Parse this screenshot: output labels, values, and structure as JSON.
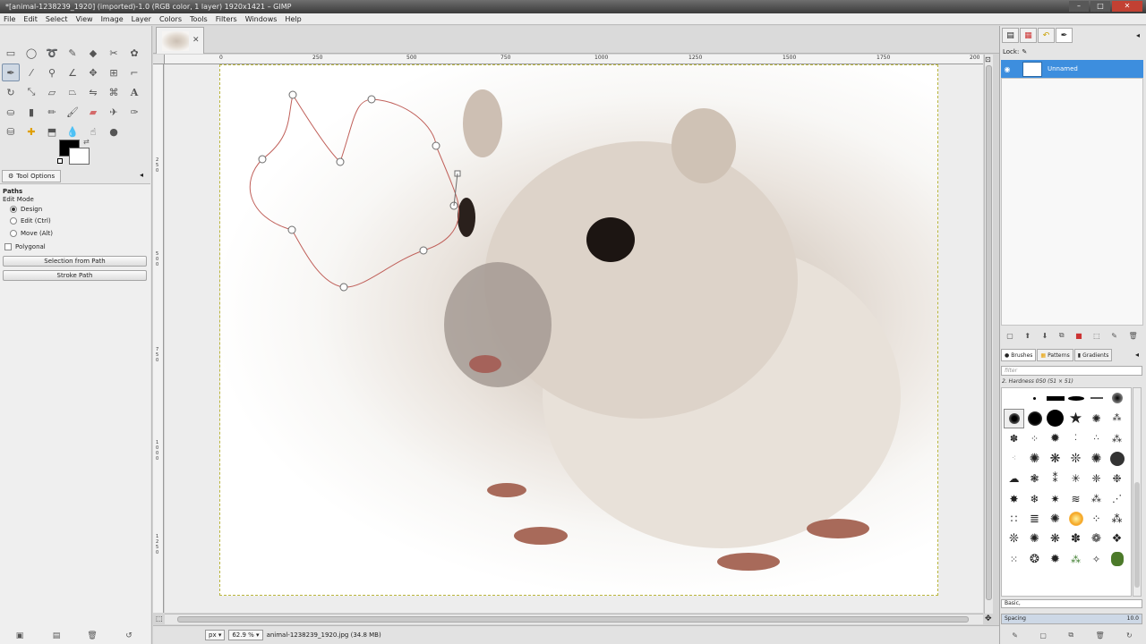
{
  "window": {
    "title": "*[animal-1238239_1920] (imported)-1.0 (RGB color, 1 layer) 1920x1421 – GIMP",
    "controls": [
      "–",
      "□",
      "✕"
    ]
  },
  "menu": [
    "File",
    "Edit",
    "Select",
    "View",
    "Image",
    "Layer",
    "Colors",
    "Tools",
    "Filters",
    "Windows",
    "Help"
  ],
  "tool_options": {
    "tab_label": "Tool Options",
    "tool_name": "Paths",
    "edit_mode_label": "Edit Mode",
    "modes": [
      "Design",
      "Edit (Ctrl)",
      "Move (Alt)"
    ],
    "selected_mode": "Design",
    "polygonal_label": "Polygonal",
    "polygonal_checked": false,
    "buttons": [
      "Selection from Path",
      "Stroke Path"
    ]
  },
  "ruler": {
    "top_labels": [
      "0",
      "250",
      "500",
      "750",
      "1000",
      "1250",
      "1500",
      "1750",
      "200"
    ],
    "left_labels": [
      "2 5 0",
      "5 0 0",
      "7 5 0",
      "1 0 0 0",
      "1 2 5 0"
    ]
  },
  "statusbar": {
    "unit": "px",
    "zoom": "62.9 %",
    "info": "animal-1238239_1920.jpg (34.8 MB)"
  },
  "layers": {
    "lock_label": "Lock:",
    "items": [
      {
        "name": "Unnamed",
        "selected": true
      }
    ]
  },
  "brushes": {
    "tabs": [
      "Brushes",
      "Patterns",
      "Gradients"
    ],
    "filter_placeholder": "filter",
    "current": "2. Hardness 050 (51 × 51)",
    "preset": "Basic,",
    "spacing_label": "Spacing",
    "spacing_value": "10.0"
  },
  "colors": {
    "foreground": "#000000",
    "background": "#ffffff",
    "path_stroke": "#c0605a",
    "selection_highlight": "#3d8ede"
  }
}
